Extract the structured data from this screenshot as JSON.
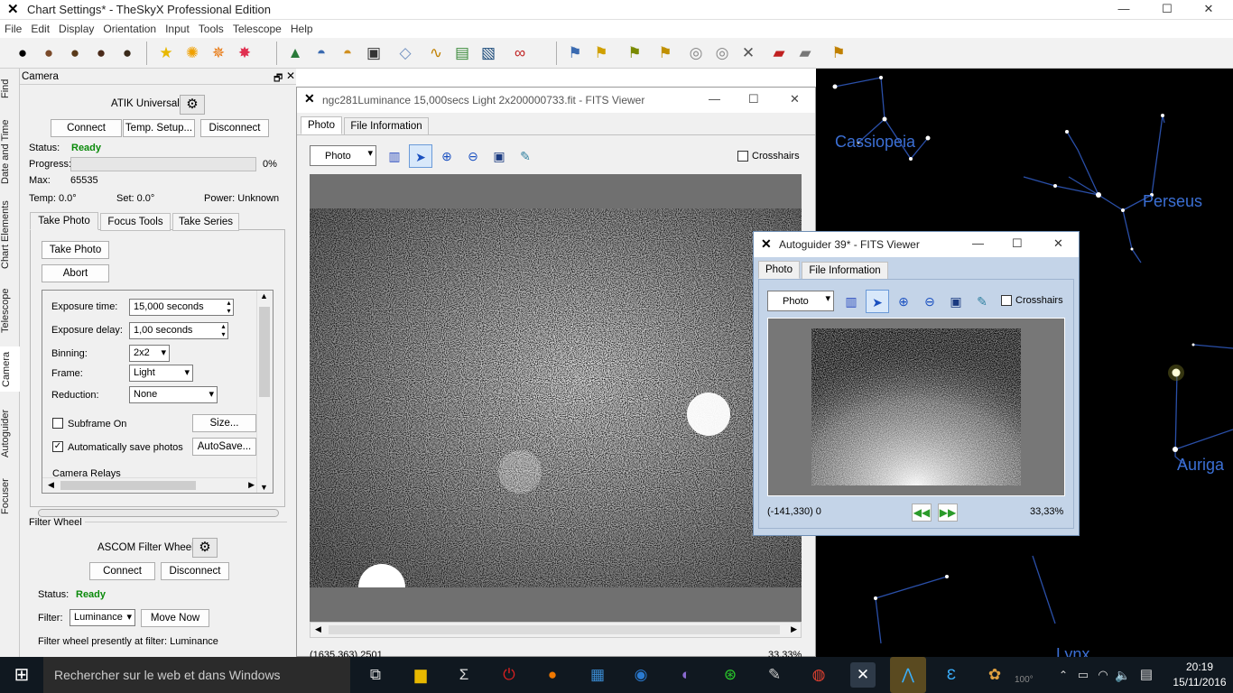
{
  "window": {
    "title": "Chart Settings* - TheSkyX Professional Edition",
    "minimize": "—",
    "maximize": "☐",
    "close": "✕"
  },
  "menu": [
    "File",
    "Edit",
    "Display",
    "Orientation",
    "Input",
    "Tools",
    "Telescope",
    "Help"
  ],
  "left_tabs": [
    "Find",
    "Date and Time",
    "Chart Elements",
    "Telescope",
    "Camera",
    "Autoguider",
    "Focuser"
  ],
  "camera_panel": {
    "title": "Camera",
    "pin": "🗗",
    "close": "✕",
    "device": "ATIK Universal",
    "connect": "Connect",
    "temp_setup": "Temp. Setup...",
    "disconnect": "Disconnect",
    "status_label": "Status:",
    "status_value": "Ready",
    "progress_label": "Progress:",
    "progress_pct": "0%",
    "progress_fraction": 0,
    "max_label": "Max:",
    "max_value": "65535",
    "temp": "Temp: 0.0°",
    "set": "Set: 0.0°",
    "power": "Power: Unknown",
    "tabs": [
      "Take Photo",
      "Focus Tools",
      "Take Series"
    ],
    "take_photo": "Take Photo",
    "abort": "Abort",
    "exposure_time_label": "Exposure time:",
    "exposure_time": "15,000 seconds",
    "exposure_delay_label": "Exposure delay:",
    "exposure_delay": "1,00 seconds",
    "binning_label": "Binning:",
    "binning": "2x2",
    "frame_label": "Frame:",
    "frame": "Light",
    "reduction_label": "Reduction:",
    "reduction": "None",
    "subframe_label": "Subframe On",
    "size_btn": "Size...",
    "autosave_label": "Automatically save photos",
    "autosave_btn": "AutoSave...",
    "relays": "Camera Relays"
  },
  "filter_wheel": {
    "title": "Filter Wheel",
    "device": "ASCOM Filter Wheel",
    "connect": "Connect",
    "disconnect": "Disconnect",
    "status_label": "Status:",
    "status_value": "Ready",
    "filter_label": "Filter:",
    "filter": "Luminance",
    "move_now": "Move Now",
    "presently": "Filter wheel presently at filter:  Luminance"
  },
  "fits_main": {
    "title": "ngc281Luminance 15,000secs Light 2x200000733.fit - FITS Viewer",
    "tabs": [
      "Photo",
      "File Information"
    ],
    "mode": "Photo",
    "crosshairs": "Crosshairs",
    "coords": "(1635,363) 2501",
    "zoom": "33,33%"
  },
  "fits_guider": {
    "title": "Autoguider 39* - FITS Viewer",
    "tabs": [
      "Photo",
      "File Information"
    ],
    "mode": "Photo",
    "crosshairs": "Crosshairs",
    "coords": "(-141,330) 0",
    "zoom": "33,33%"
  },
  "sky": {
    "labels": [
      "Cassiopeia",
      "Perseus",
      "Auriga",
      "Lynx"
    ]
  },
  "taskbar": {
    "search": "Rechercher sur le web et dans Windows",
    "time": "20:19",
    "date": "15/11/2016",
    "temp_partial": "100°"
  },
  "colors": {
    "ready": "#0a8a0a",
    "sky_label": "#3b6fd4",
    "guider_bg": "#c4d4e8"
  }
}
